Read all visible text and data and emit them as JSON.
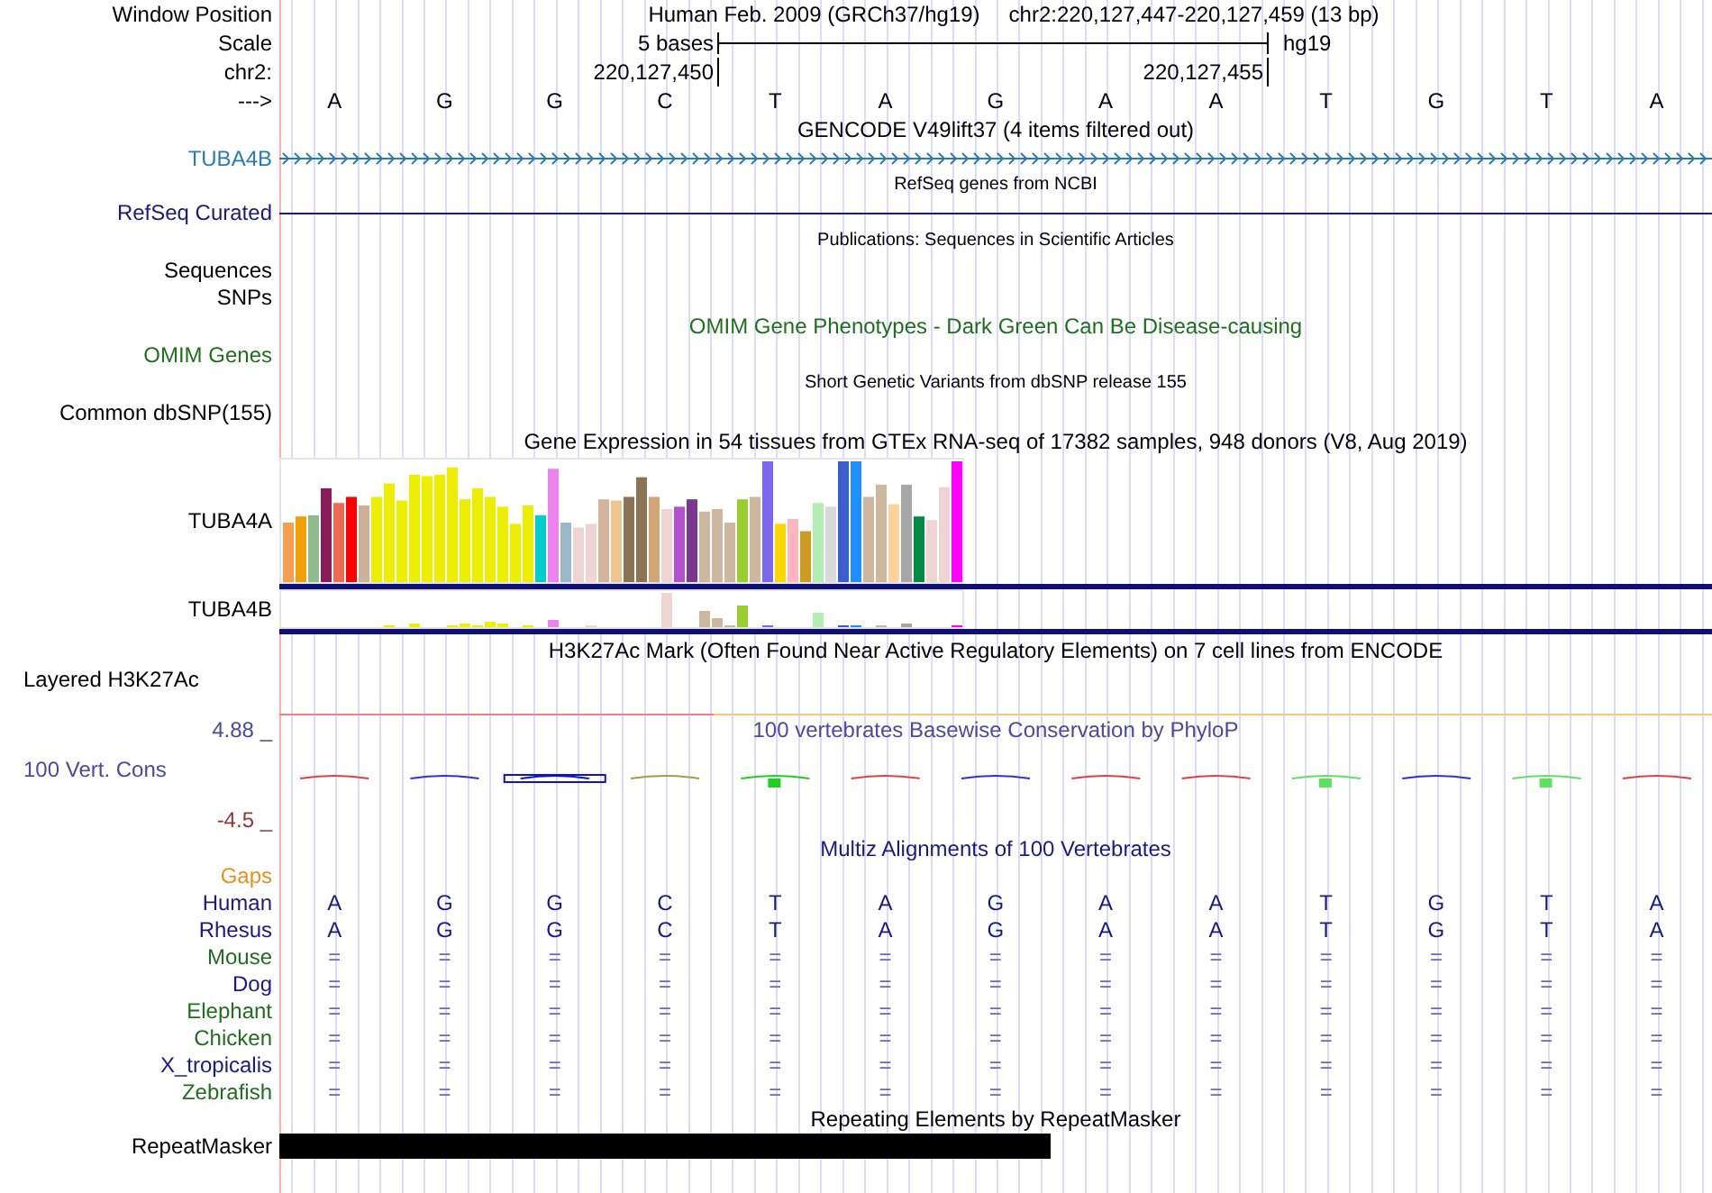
{
  "header": {
    "position_label": "Window Position",
    "assembly": "Human Feb. 2009 (GRCh37/hg19)",
    "range": "chr2:220,127,447-220,127,459 (13 bp)",
    "scale_label": "Scale",
    "scale_span": "5 bases",
    "scale_db": "hg19",
    "chrom_label": "chr2:",
    "coord_start": "220,127,450",
    "coord_end": "220,127,455",
    "strand_label": "--->",
    "bases": [
      "A",
      "G",
      "G",
      "C",
      "T",
      "A",
      "G",
      "A",
      "A",
      "T",
      "G",
      "T",
      "A"
    ]
  },
  "tracks": [
    {
      "kind": "gene",
      "title": "GENCODE V49lift37 (4 items filtered out)",
      "small": false,
      "label": "TUBA4B",
      "color": "#2a7ab8"
    },
    {
      "kind": "line",
      "title": "RefSeq genes from NCBI",
      "small": true,
      "label": "RefSeq Curated",
      "color": "#1a1a78"
    },
    {
      "kind": "title",
      "title": "Publications: Sequences in Scientific Articles",
      "small": true
    },
    {
      "kind": "labels",
      "labels": [
        "Sequences",
        "SNPs"
      ]
    },
    {
      "kind": "plain",
      "title": "OMIM Gene Phenotypes - Dark Green Can Be Disease-causing",
      "small": false,
      "label": "OMIM Genes",
      "color": "#1f6f1f"
    },
    {
      "kind": "plain",
      "title": "Short Genetic Variants from dbSNP release 155",
      "small": true,
      "label": "Common dbSNP(155)",
      "color": "#000000"
    },
    {
      "kind": "expression",
      "title": "Gene Expression in 54 tissues from GTEx RNA-seq of 17382 samples, 948 donors (V8, Aug 2019)",
      "small": false,
      "genes": [
        "TUBA4A",
        "TUBA4B"
      ]
    },
    {
      "kind": "layered",
      "title": "H3K27Ac Mark (Often Found Near Active Regulatory Elements) on 7 cell lines from ENCODE",
      "small": false,
      "label": "Layered H3K27Ac"
    },
    {
      "kind": "wiggle",
      "title": "100 vertebrates Basewise Conservation by PhyloP",
      "small": false,
      "label": "100 Vert. Cons",
      "upper": "4.88 _",
      "color": "#4a4a9e",
      "lower": {
        "text": "-4.5 _",
        "color": "#8b3a3a"
      }
    },
    {
      "kind": "multiz",
      "title": "Multiz Alignments of 100 Vertebrates",
      "small": false,
      "gaps": {
        "text": "Gaps",
        "color": "#e8901a"
      },
      "species": [
        {
          "name": "Human",
          "color": "#1a1a80",
          "bases": [
            "A",
            "G",
            "G",
            "C",
            "T",
            "A",
            "G",
            "A",
            "A",
            "T",
            "G",
            "T",
            "A"
          ]
        },
        {
          "name": "Rhesus",
          "color": "#1a1a80",
          "bases": [
            "A",
            "G",
            "G",
            "C",
            "T",
            "A",
            "G",
            "A",
            "A",
            "T",
            "G",
            "T",
            "A"
          ]
        },
        {
          "name": "Mouse",
          "color": "#1f6f1f",
          "bases": [
            "=",
            "=",
            "=",
            "=",
            "=",
            "=",
            "=",
            "=",
            "=",
            "=",
            "=",
            "=",
            "="
          ]
        },
        {
          "name": "Dog",
          "color": "#1a1a80",
          "bases": [
            "=",
            "=",
            "=",
            "=",
            "=",
            "=",
            "=",
            "=",
            "=",
            "=",
            "=",
            "=",
            "="
          ]
        },
        {
          "name": "Elephant",
          "color": "#1f6f1f",
          "bases": [
            "=",
            "=",
            "=",
            "=",
            "=",
            "=",
            "=",
            "=",
            "=",
            "=",
            "=",
            "=",
            "="
          ]
        },
        {
          "name": "Chicken",
          "color": "#1f6f1f",
          "bases": [
            "=",
            "=",
            "=",
            "=",
            "=",
            "=",
            "=",
            "=",
            "=",
            "=",
            "=",
            "=",
            "="
          ]
        },
        {
          "name": "X_tropicalis",
          "color": "#1a1a80",
          "bases": [
            "=",
            "=",
            "=",
            "=",
            "=",
            "=",
            "=",
            "=",
            "=",
            "=",
            "=",
            "=",
            "="
          ]
        },
        {
          "name": "Zebrafish",
          "color": "#1f6f1f",
          "bases": [
            "=",
            "=",
            "=",
            "=",
            "=",
            "=",
            "=",
            "=",
            "=",
            "=",
            "=",
            "=",
            "="
          ]
        }
      ]
    },
    {
      "kind": "repeat",
      "title": "Repeating Elements by RepeatMasker",
      "small": false,
      "label": "RepeatMasker"
    }
  ]
}
